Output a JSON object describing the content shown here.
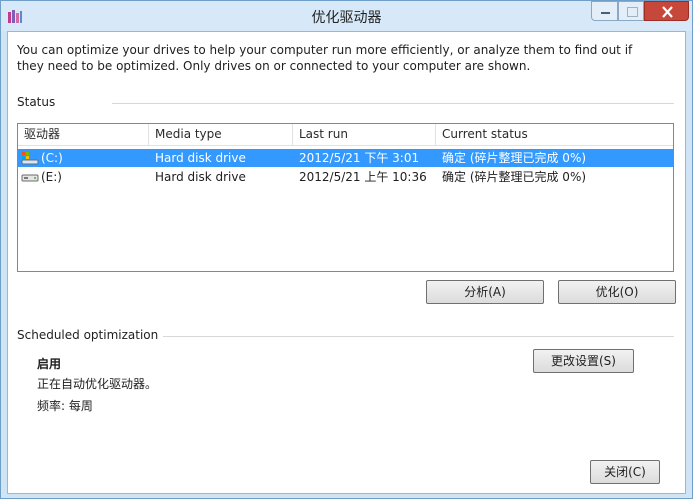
{
  "window": {
    "title": "优化驱动器"
  },
  "intro": "You can optimize your drives to help your computer run more efficiently, or analyze them to find out if they need to be optimized. Only drives on or connected to your computer are shown.",
  "status": {
    "label": "Status",
    "columns": [
      "驱动器",
      "Media type",
      "Last run",
      "Current status"
    ],
    "rows": [
      {
        "drive": "(C:)",
        "media_type": "Hard disk drive",
        "last_run": "2012/5/21 下午 3:01",
        "current_status": "确定 (碎片整理已完成 0%)",
        "icon": "system-drive-icon",
        "selected": true
      },
      {
        "drive": "(E:)",
        "media_type": "Hard disk drive",
        "last_run": "2012/5/21 上午 10:36",
        "current_status": "确定 (碎片整理已完成 0%)",
        "icon": "hard-drive-icon",
        "selected": false
      }
    ],
    "analyze_button": "分析(A)",
    "optimize_button": "优化(O)"
  },
  "schedule": {
    "label": "Scheduled optimization",
    "state": "启用",
    "description": "正在自动优化驱动器。",
    "frequency": "频率: 每周",
    "change_settings_button": "更改设置(S)"
  },
  "footer": {
    "close_button": "关闭(C)"
  },
  "colors": {
    "selection": "#3399ff",
    "title_bar": "#d7e9f8",
    "close_button": "#c7473a"
  }
}
